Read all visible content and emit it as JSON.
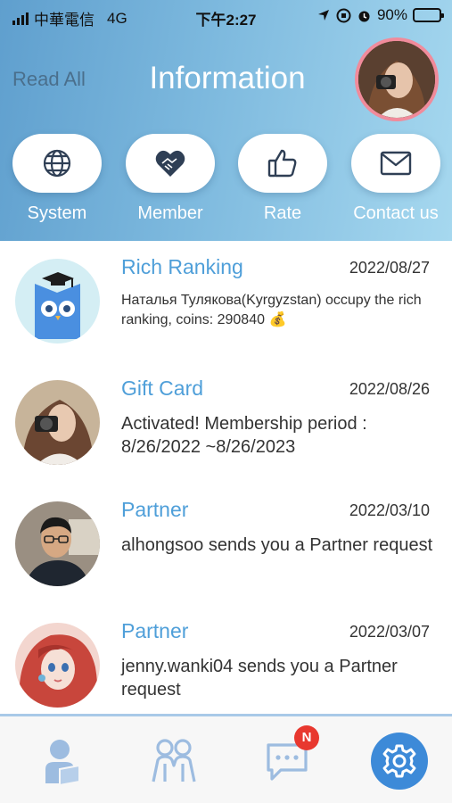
{
  "status_bar": {
    "carrier": "中華電信",
    "network": "4G",
    "time": "下午2:27",
    "battery": "90%",
    "battery_level": 0.9
  },
  "header": {
    "read_all": "Read All",
    "title": "Information",
    "categories": [
      {
        "label": "System",
        "icon": "globe-icon"
      },
      {
        "label": "Member",
        "icon": "heart-handshake-icon"
      },
      {
        "label": "Rate",
        "icon": "thumbs-up-icon"
      },
      {
        "label": "Contact us",
        "icon": "envelope-icon"
      }
    ]
  },
  "messages": [
    {
      "title": "Rich Ranking",
      "date": "2022/08/27",
      "text": "Наталья Тулякова(Kyrgyzstan) occupy the rich ranking, coins: 290840 💰",
      "avatar": "owl-logo"
    },
    {
      "title": "Gift Card",
      "date": "2022/08/26",
      "text": "Activated! Membership period : 8/26/2022 ~8/26/2023",
      "avatar": "woman-camera-photo"
    },
    {
      "title": "Partner",
      "date": "2022/03/10",
      "text": "alhongsoo  sends you a Partner request",
      "avatar": "man-glasses-photo"
    },
    {
      "title": "Partner",
      "date": "2022/03/07",
      "text": "jenny.wanki04  sends you a Partner request",
      "avatar": "redhair-illustration"
    }
  ],
  "tabbar": {
    "tabs": [
      {
        "icon": "profile-icon"
      },
      {
        "icon": "people-icon"
      },
      {
        "icon": "chat-icon",
        "badge": "N"
      },
      {
        "icon": "settings-icon",
        "active": true
      }
    ]
  },
  "colors": {
    "accent": "#4f9fd9",
    "active_tab": "#3d8ad8",
    "badge": "#e8382f",
    "avatar_ring": "#f08b9b"
  }
}
